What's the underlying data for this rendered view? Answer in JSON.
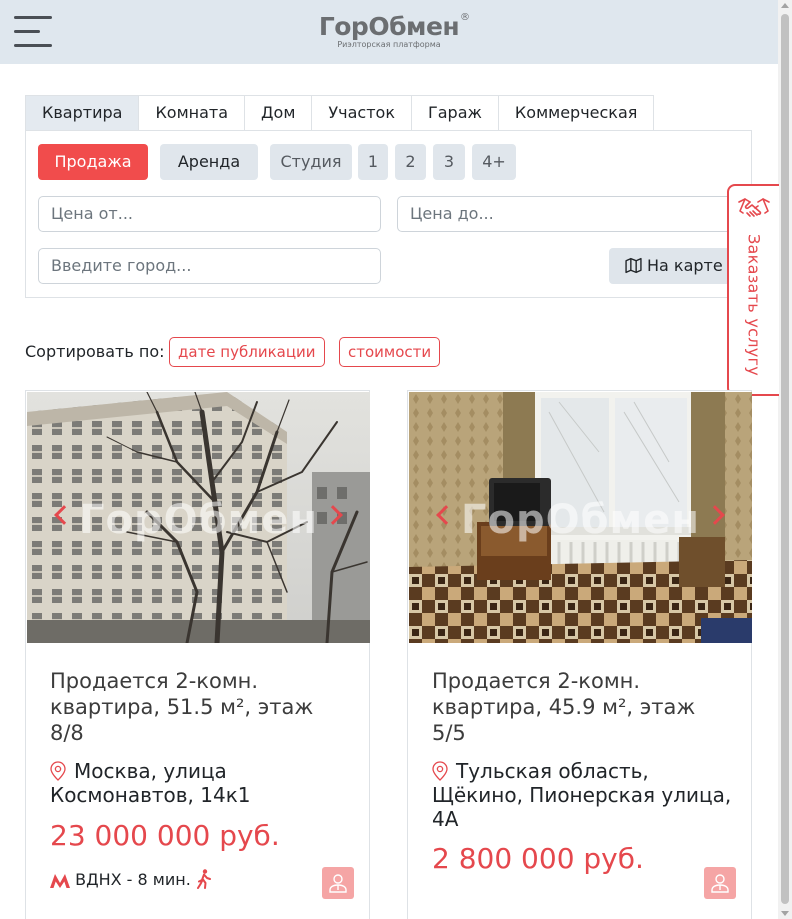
{
  "header": {
    "logo_text": "ГорОбмен",
    "logo_reg": "®",
    "logo_subtitle": "Риэлторская платформа"
  },
  "search": {
    "tabs": [
      "Квартира",
      "Комната",
      "Дом",
      "Участок",
      "Гараж",
      "Коммерческая"
    ],
    "active_tab": "Квартира",
    "deal_sale": "Продажа",
    "deal_rent": "Аренда",
    "rooms": [
      "Студия",
      "1",
      "2",
      "3",
      "4+"
    ],
    "price_from_placeholder": "Цена от...",
    "price_to_placeholder": "Цена до...",
    "city_placeholder": "Введите город...",
    "map_button": "На карте"
  },
  "side_tab": {
    "label": "Заказать услугу"
  },
  "sort": {
    "label": "Сортировать по:",
    "by_date": "дате публикации",
    "by_price": "стоимости"
  },
  "watermark": "ГорОбмен",
  "listings": [
    {
      "title": "Продается 2-комн. квартира, 51.5 м², этаж 8/8",
      "address": "Москва, улица Космонавтов, 14к1",
      "price": "23 000 000 руб.",
      "metro": "ВДНХ - 8 мин."
    },
    {
      "title": "Продается 2-комн. квартира, 45.9 м², этаж 5/5",
      "address": "Тульская область, Щёкино, Пионерская улица, 4А",
      "price": "2 800 000 руб."
    }
  ],
  "colors": {
    "accent": "#e5484d",
    "header_bg": "#dfe7ee",
    "button_gray": "#e0e6ec"
  }
}
